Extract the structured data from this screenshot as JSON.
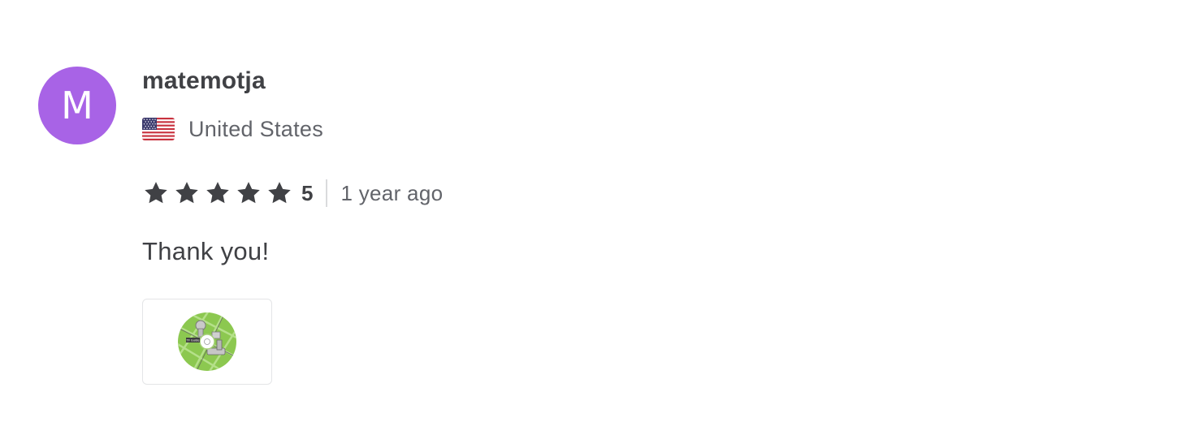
{
  "reviewer": {
    "avatar_initial": "M",
    "avatar_color": "#a863e6",
    "username": "matemotja",
    "country": "United States",
    "flag_icon": "us-flag-icon"
  },
  "rating": {
    "stars": 5,
    "max_stars": 5,
    "value_label": "5",
    "time_ago": "1 year ago"
  },
  "review": {
    "text": "Thank you!"
  },
  "attachment": {
    "icon": "cd-disc-image",
    "disc_label": "TF Guide"
  },
  "colors": {
    "text_primary": "#404145",
    "text_secondary": "#62646a",
    "divider": "#dadbdd",
    "star": "#404145"
  }
}
